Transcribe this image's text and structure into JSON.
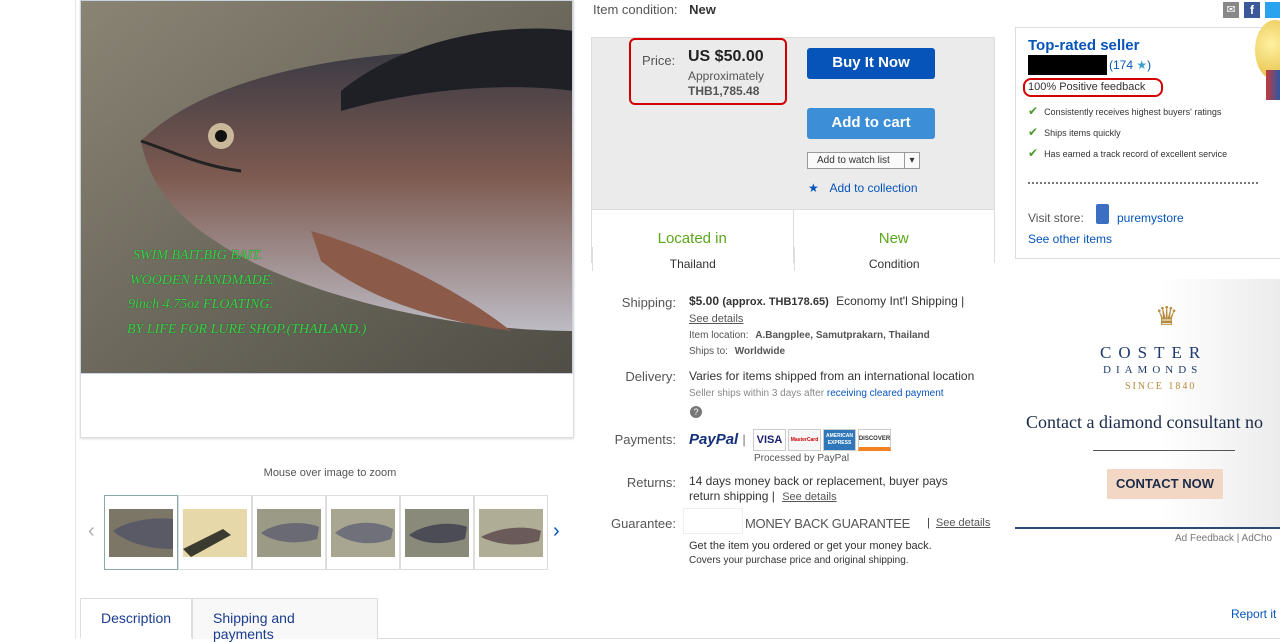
{
  "image_panel": {
    "caption_lines": [
      "SWIM BAIT,BIG BAIT.",
      "WOODEN HANDMADE.",
      "9inch 4.75oz  FLOATING.",
      "BY LIFE FOR LURE SHOP.(THAILAND.)"
    ],
    "zoom_hint": "Mouse over image to zoom",
    "thumbnails": [
      "thumb-1",
      "thumb-2",
      "thumb-3",
      "thumb-4",
      "thumb-5",
      "thumb-6"
    ]
  },
  "item": {
    "condition_label": "Item condition:",
    "condition_value": "New",
    "price_label": "Price:",
    "price": "US $50.00",
    "approx_label": "Approximately",
    "approx_value": "THB1,785.48",
    "buy_now": "Buy It Now",
    "add_to_cart": "Add to cart",
    "watch_list": "Add to watch list",
    "add_collection": "Add to collection",
    "located_title": "Located in",
    "located_value": "Thailand",
    "cond_title": "New",
    "cond_sub": "Condition"
  },
  "shipping": {
    "label": "Shipping:",
    "price": "$5.00",
    "approx": "(approx. THB178.65)",
    "method": "Economy Int'l Shipping |",
    "see_details": "See details",
    "location_label": "Item location:",
    "location_value": "A.Bangplee, Samutprakarn, Thailand",
    "ships_to_label": "Ships to:",
    "ships_to_value": "Worldwide"
  },
  "delivery": {
    "label": "Delivery:",
    "text": "Varies for items shipped from an international location",
    "note": "Seller ships within 3 days after",
    "note_link": "receiving cleared payment"
  },
  "payments": {
    "label": "Payments:",
    "paypal": "PayPal",
    "cards": [
      "VISA",
      "MasterCard",
      "AMERICAN EXPRESS",
      "DISCOVER"
    ],
    "processed": "Processed by PayPal"
  },
  "returns": {
    "label": "Returns:",
    "text1": "14 days money back or replacement, buyer pays",
    "text2": "return shipping |",
    "see_details": "See details"
  },
  "guarantee": {
    "label": "Guarantee:",
    "title": "MONEY BACK GUARANTEE",
    "see_details": "See details",
    "line1": "Get the item you ordered or get your money back.",
    "line2": "Covers your purchase price and original shipping."
  },
  "seller": {
    "title": "Top-rated seller",
    "rating": "(174",
    "feedback": "100% Positive feedback",
    "points": [
      "Consistently receives highest buyers' ratings",
      "Ships items quickly",
      "Has earned a track record of excellent service"
    ],
    "visit_store": "Visit store:",
    "store_name": "puremystore",
    "other_items": "See other items"
  },
  "ad": {
    "brand1": "COSTER",
    "brand2": "DIAMONDS",
    "since": "SINCE 1840",
    "headline": "Contact a diamond consultant no",
    "cta": "CONTACT NOW",
    "feedback": "Ad Feedback",
    "adchoices": "AdCho"
  },
  "tabs": [
    "Description",
    "Shipping and payments"
  ],
  "report": "Report it",
  "colors": {
    "link": "#0654ba",
    "button": "#0654ba",
    "green": "#5ba71b",
    "highlight": "#d40000"
  }
}
